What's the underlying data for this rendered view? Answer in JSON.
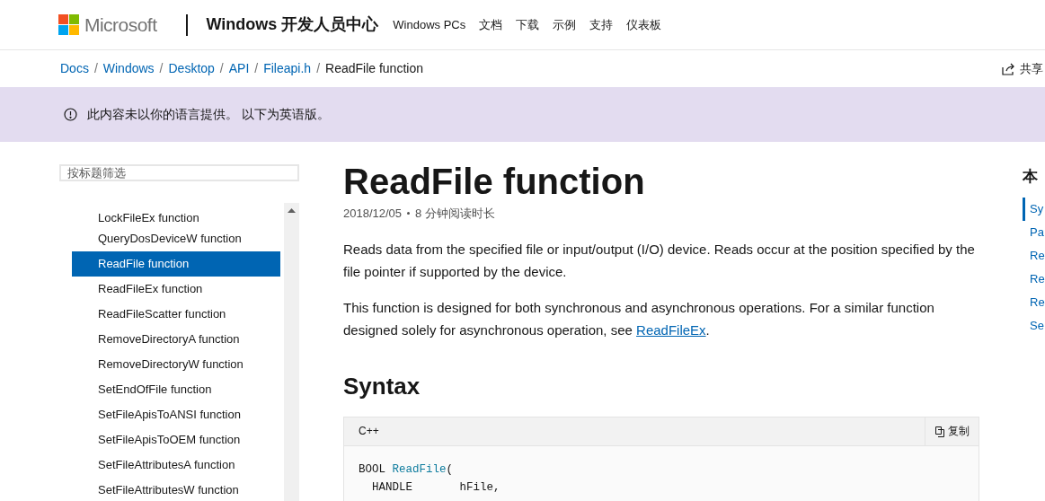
{
  "header": {
    "brand": "Microsoft",
    "site": "Windows 开发人员中心",
    "nav": [
      "Windows PCs",
      "文档",
      "下载",
      "示例",
      "支持",
      "仪表板"
    ]
  },
  "breadcrumbs": [
    {
      "label": "Docs",
      "separator": "/"
    },
    {
      "label": "Windows",
      "separator": "/"
    },
    {
      "label": "Desktop",
      "separator": "/"
    },
    {
      "label": "API",
      "separator": "/"
    },
    {
      "label": "Fileapi.h",
      "separator": "/"
    }
  ],
  "current_page": "ReadFile function",
  "share": "共享",
  "banner": "此内容未以你的语言提供。 以下为英语版。",
  "sidebar": {
    "filter_placeholder": "按标题筛选",
    "items": [
      {
        "label": "LockFileEx function",
        "selected": false
      },
      {
        "label": "QueryDosDeviceW function",
        "selected": false
      },
      {
        "label": "ReadFile function",
        "selected": true
      },
      {
        "label": "ReadFileEx function",
        "selected": false
      },
      {
        "label": "ReadFileScatter function",
        "selected": false
      },
      {
        "label": "RemoveDirectoryA function",
        "selected": false
      },
      {
        "label": "RemoveDirectoryW function",
        "selected": false
      },
      {
        "label": "SetEndOfFile function",
        "selected": false
      },
      {
        "label": "SetFileApisToANSI function",
        "selected": false
      },
      {
        "label": "SetFileApisToOEM function",
        "selected": false
      },
      {
        "label": "SetFileAttributesA function",
        "selected": false
      },
      {
        "label": "SetFileAttributesW function",
        "selected": false
      }
    ]
  },
  "article": {
    "title": "ReadFile function",
    "date": "2018/12/05",
    "read_time": "8 分钟阅读时长",
    "paragraph_1": "Reads data from the specified file or input/output (I/O) device. Reads occur at the position specified by the file pointer if supported by the device.",
    "paragraph_2": "This function is designed for both synchronous and asynchronous operations. For a similar function designed solely for asynchronous operation, see",
    "paragraph_2_link": "ReadFileEx",
    "paragraph_2_end": ".",
    "section_heading": "Syntax",
    "code": {
      "language": "C++",
      "copy": "复制",
      "lines": [
        [
          {
            "text": "BOOL ",
            "kind": "plain"
          },
          {
            "text": "ReadFile",
            "kind": "function"
          },
          {
            "text": "(",
            "kind": "plain"
          }
        ],
        [
          {
            "text": "  HANDLE       hFile,",
            "kind": "plain"
          }
        ]
      ]
    }
  },
  "toc": {
    "heading": "本",
    "items": [
      {
        "label": "Sy",
        "selected": true
      },
      {
        "label": "Pa",
        "selected": false
      },
      {
        "label": "Re",
        "selected": false
      },
      {
        "label": "Re",
        "selected": false
      },
      {
        "label": "Re",
        "selected": false
      },
      {
        "label": "Se",
        "selected": false
      }
    ]
  }
}
